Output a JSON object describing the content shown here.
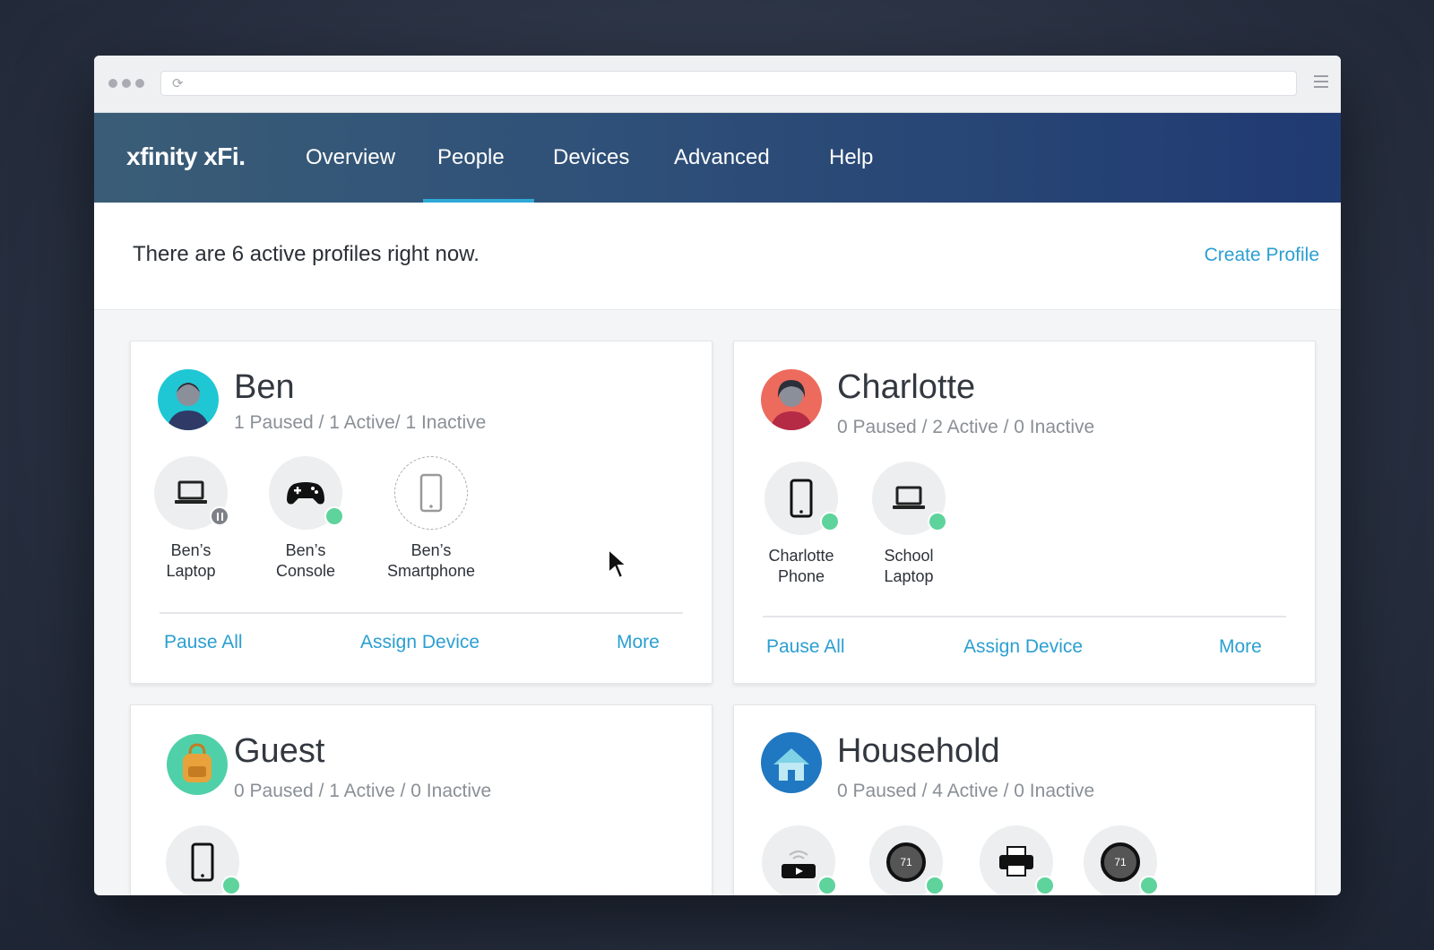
{
  "browser": {
    "url": ""
  },
  "brand": {
    "logo": "xfinity xFi."
  },
  "nav": {
    "items": [
      "Overview",
      "People",
      "Devices",
      "Advanced",
      "Help"
    ],
    "active": "People"
  },
  "summary": {
    "text": "There are 6 active profiles right now.",
    "create_label": "Create Profile"
  },
  "colors": {
    "accent": "#2b9fd1",
    "active_dot": "#5fd39c",
    "paused_dot": "#7d8187",
    "nav_start": "#3a5d77",
    "nav_end": "#203a72"
  },
  "profiles": [
    {
      "name": "Ben",
      "stats": "1 Paused / 1 Active/ 1 Inactive",
      "avatar_icon": "person-avatar-icon",
      "devices": [
        {
          "label_1": "Ben’s",
          "label_2": "Laptop",
          "icon": "laptop-icon",
          "status": "paused"
        },
        {
          "label_1": "Ben’s",
          "label_2": "Console",
          "icon": "gamepad-icon",
          "status": "active"
        },
        {
          "label_1": "Ben’s",
          "label_2": "Smartphone",
          "icon": "smartphone-icon",
          "status": "inactive"
        }
      ],
      "actions": {
        "pause": "Pause All",
        "assign": "Assign Device",
        "more": "More"
      }
    },
    {
      "name": "Charlotte",
      "stats": "0 Paused / 2 Active / 0 Inactive",
      "avatar_icon": "person-avatar-icon",
      "devices": [
        {
          "label_1": "Charlotte",
          "label_2": "Phone",
          "icon": "smartphone-icon",
          "status": "active"
        },
        {
          "label_1": "School",
          "label_2": "Laptop",
          "icon": "laptop-icon",
          "status": "active"
        }
      ],
      "actions": {
        "pause": "Pause All",
        "assign": "Assign Device",
        "more": "More"
      }
    },
    {
      "name": "Guest",
      "stats": "0 Paused / 1 Active / 0 Inactive",
      "avatar_icon": "backpack-icon",
      "devices": [
        {
          "icon": "smartphone-icon",
          "status": "active"
        }
      ]
    },
    {
      "name": "Household",
      "stats": "0 Paused / 4 Active / 0 Inactive",
      "avatar_icon": "house-icon",
      "devices": [
        {
          "icon": "streaming-box-icon",
          "status": "active"
        },
        {
          "icon": "thermostat-icon",
          "status": "active",
          "value": "71"
        },
        {
          "icon": "printer-icon",
          "status": "active"
        },
        {
          "icon": "thermostat-icon",
          "status": "active",
          "value": "71"
        }
      ]
    }
  ]
}
